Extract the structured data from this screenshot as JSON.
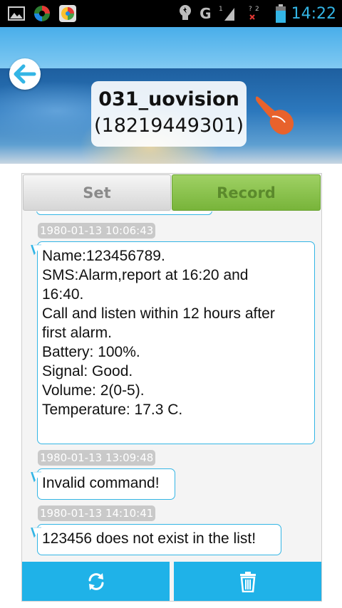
{
  "status_bar": {
    "network_label": "G",
    "sim1_label": "1",
    "sim2_label": "2",
    "time": "14:22",
    "icons": [
      "gallery-icon",
      "app-icon",
      "browser-icon",
      "bulb-icon",
      "signal-icon",
      "battery-icon"
    ]
  },
  "header": {
    "back_icon": "arrow-left-icon",
    "device_name": "031_uovision",
    "device_phone": "(18219449301)",
    "hand_icon": "pointing-hand-icon"
  },
  "tabs": [
    {
      "label": "Set",
      "selected": false
    },
    {
      "label": "Record",
      "selected": true
    }
  ],
  "messages": [
    {
      "timestamp": "1980-01-13 10:06:43",
      "lines": [
        "Name:123456789.",
        "SMS:Alarm,report at 16:20 and",
        "16:40.",
        "Call and listen within 12 hours after",
        "first alarm.",
        "Battery: 100%.",
        "Signal: Good.",
        "Volume: 2(0-5).",
        "Temperature: 17.3 C."
      ]
    },
    {
      "timestamp": "1980-01-13 13:09:48",
      "lines": [
        "Invalid command!"
      ]
    },
    {
      "timestamp": "1980-01-13 14:10:41",
      "lines": [
        "123456 does not exist in the list!"
      ]
    }
  ],
  "actions": {
    "refresh_icon": "refresh-icon",
    "delete_icon": "trash-icon"
  },
  "colors": {
    "accent": "#33b5e5",
    "record_tab": "#8cc152",
    "action_bar": "#1fb2e8"
  }
}
